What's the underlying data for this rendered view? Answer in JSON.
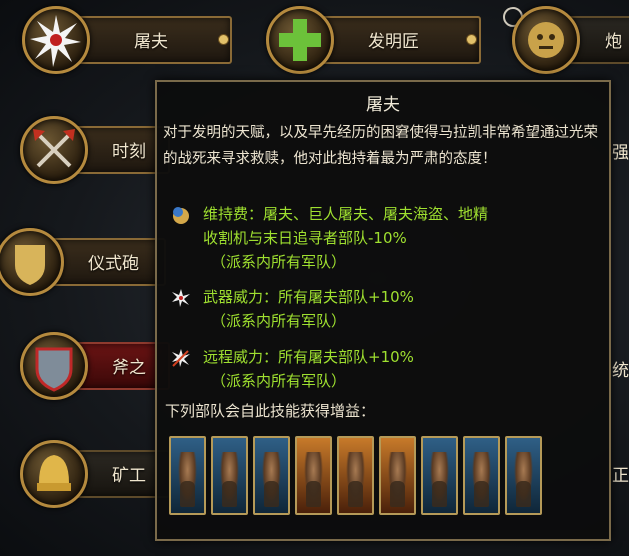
{
  "skills": [
    {
      "label": "屠夫",
      "icon": "butcher-star-icon"
    },
    {
      "label": "发明匠",
      "icon": "green-cross-icon"
    },
    {
      "label": "炮",
      "icon": "cannon-face-icon"
    },
    {
      "label": "时刻",
      "icon": "crossed-axes-icon"
    },
    {
      "label": "仪式砲",
      "icon": "gold-shield-icon"
    },
    {
      "label": "斧之",
      "icon": "grey-shield-icon"
    },
    {
      "label": "矿工",
      "icon": "gold-helmet-icon"
    }
  ],
  "partial_right": [
    "强",
    "统",
    "正"
  ],
  "tooltip": {
    "title": "屠夫",
    "description": "对于发明的天赋，以及早先经历的困窘使得马拉凯非常希望通过光荣的战死来寻求救赎，他对此抱持着最为严肃的态度！",
    "effects": [
      {
        "icon": "coin-upkeep-icon",
        "line1": "维持费：屠夫、巨人屠夫、屠夫海盗、地精",
        "line2": "收割机与末日追寻者部队-10%",
        "line3": "（派系内所有军队）"
      },
      {
        "icon": "weapon-strength-icon",
        "line1": "武器威力：所有屠夫部队+10%",
        "line2": "（派系内所有军队）"
      },
      {
        "icon": "ranged-strength-icon",
        "line1": "远程威力：所有屠夫部队+10%",
        "line2": "（派系内所有军队）"
      }
    ],
    "units_label": "下列部队会自此技能获得增益：",
    "unit_cards": [
      {
        "name": "unit-card-1",
        "color": "blue"
      },
      {
        "name": "unit-card-2",
        "color": "blue"
      },
      {
        "name": "unit-card-3",
        "color": "blue"
      },
      {
        "name": "unit-card-4",
        "color": "orange"
      },
      {
        "name": "unit-card-5",
        "color": "orange"
      },
      {
        "name": "unit-card-6",
        "color": "orange"
      },
      {
        "name": "unit-card-7",
        "color": "blue"
      },
      {
        "name": "unit-card-8",
        "color": "blue"
      },
      {
        "name": "unit-card-9",
        "color": "blue"
      }
    ]
  }
}
